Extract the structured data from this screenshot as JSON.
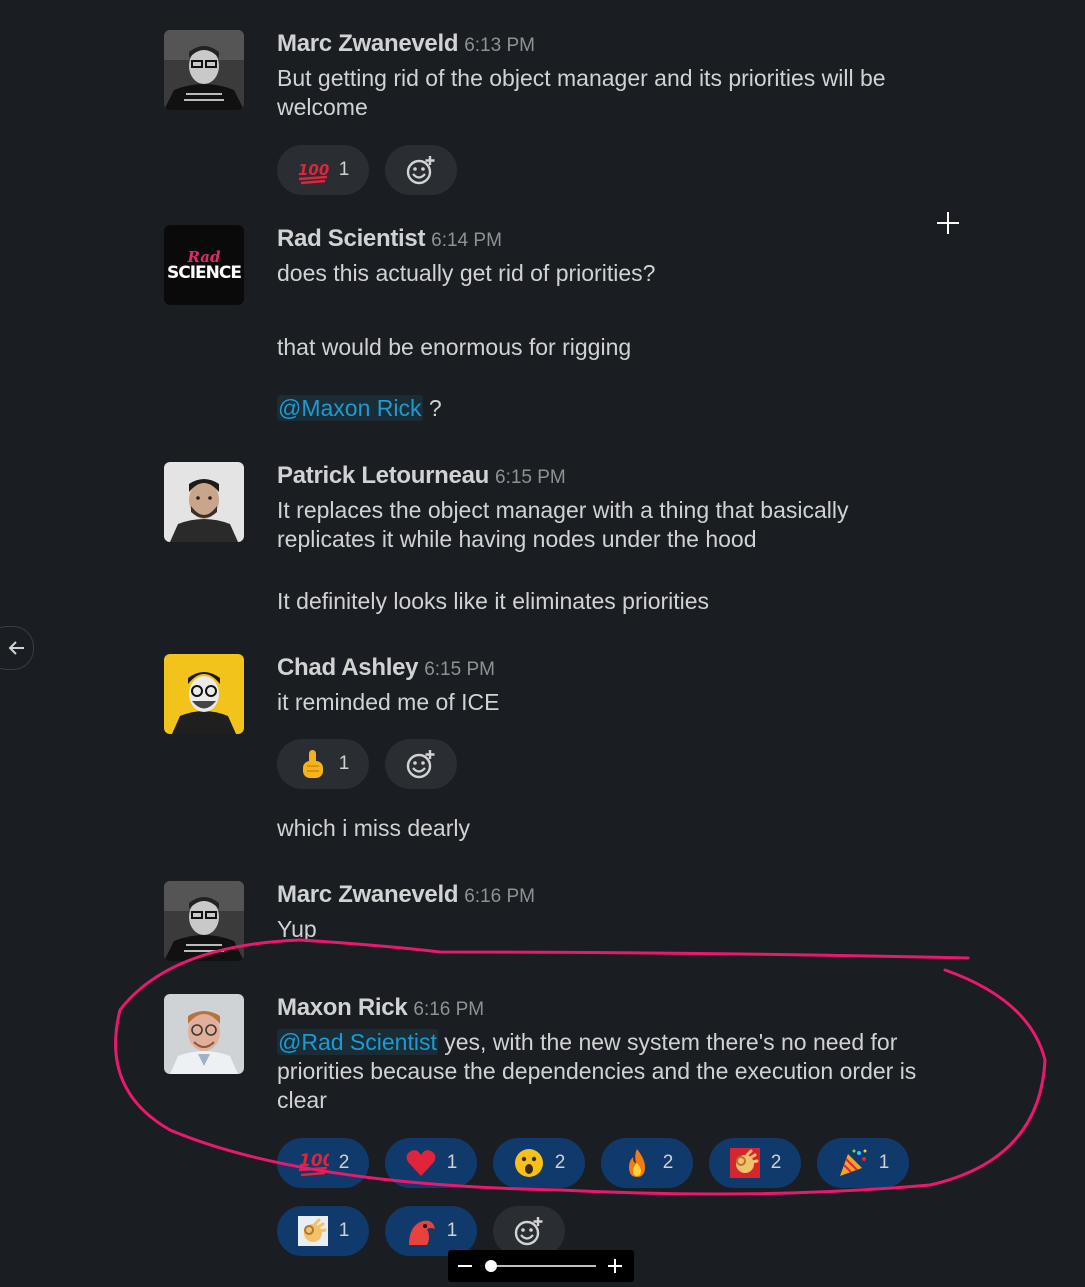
{
  "messages": [
    {
      "author": "Marc Zwaneveld",
      "time": "6:13 PM",
      "lines": [
        "But getting rid of the object manager and its priorities will be welcome"
      ],
      "reactions": [
        {
          "emoji": "1000-emoji",
          "count": "1"
        }
      ]
    },
    {
      "author": "Rad Scientist",
      "time": "6:14 PM",
      "avatar_text": [
        "Rad",
        "SCIENCE"
      ],
      "lines": [
        "does this actually get rid of priorities?",
        "that would be enormous for rigging"
      ],
      "mention_line": {
        "mention": "@Maxon Rick",
        "rest": " ?"
      }
    },
    {
      "author": "Patrick Letourneau",
      "time": "6:15 PM",
      "lines": [
        "It replaces the object manager with a thing that basically replicates it while having nodes under the hood",
        "It definitely looks like it eliminates priorities"
      ]
    },
    {
      "author": "Chad Ashley",
      "time": "6:15 PM",
      "lines": [
        "it reminded me of ICE",
        "which i miss dearly"
      ],
      "reactions": [
        {
          "emoji": "point-up-emoji",
          "count": "1"
        }
      ]
    },
    {
      "author": "Marc Zwaneveld",
      "time": "6:16 PM",
      "lines": [
        "Yup"
      ]
    },
    {
      "author": "Maxon Rick",
      "time": "6:16 PM",
      "mention": "@Rad Scientist",
      "text": " yes, with the new system there's no need for priorities because the dependencies and the execution order is clear",
      "reactions": [
        {
          "emoji": "100-emoji",
          "count": "2"
        },
        {
          "emoji": "heart-emoji",
          "count": "1"
        },
        {
          "emoji": "open-mouth-emoji",
          "count": "2"
        },
        {
          "emoji": "fire-emoji",
          "count": "2"
        },
        {
          "emoji": "ok-hand-red-emoji",
          "count": "2"
        },
        {
          "emoji": "party-popper-emoji",
          "count": "1"
        },
        {
          "emoji": "ok-hand-emoji",
          "count": "1"
        },
        {
          "emoji": "parrot-emoji",
          "count": "1"
        }
      ]
    }
  ],
  "colors": {
    "background": "#1a1d21",
    "text": "#d1d2d3",
    "timestamp": "#8f9193",
    "mention": "#1d9bd1",
    "reaction_bg": "#2a2e33",
    "reaction_mine_bg": "#0f3a6b",
    "annotation": "#e8196e"
  },
  "icons": [
    "plus-cursor-icon",
    "arrow-left-icon",
    "add-reaction-icon",
    "zoom-minus-icon",
    "zoom-plus-icon"
  ]
}
